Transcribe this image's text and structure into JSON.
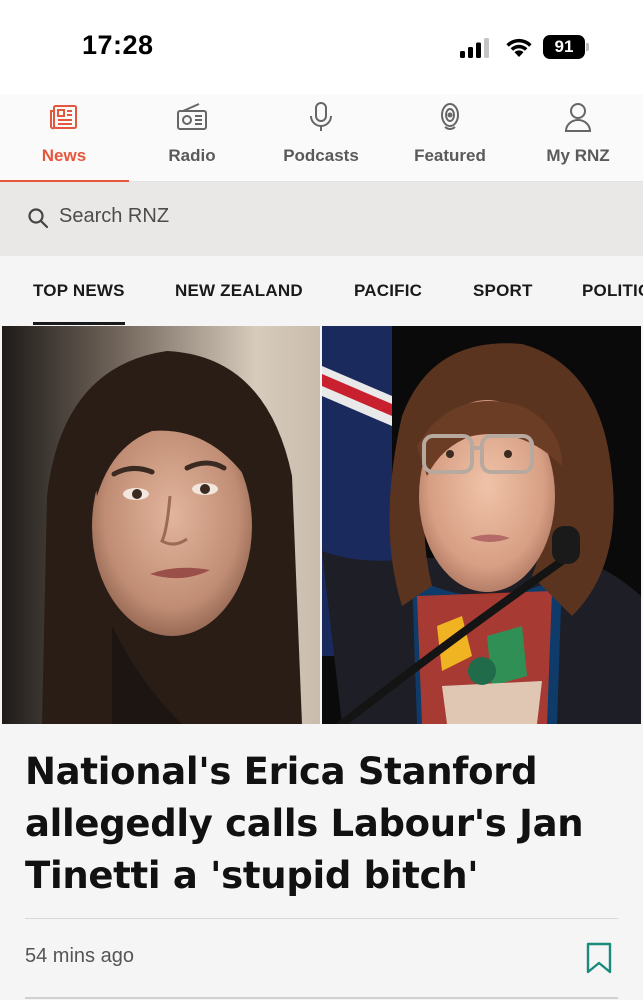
{
  "status_bar": {
    "time": "17:28",
    "battery": "91"
  },
  "nav": {
    "items": [
      {
        "label": "News",
        "icon": "newspaper-icon",
        "active": true
      },
      {
        "label": "Radio",
        "icon": "radio-icon",
        "active": false
      },
      {
        "label": "Podcasts",
        "icon": "microphone-icon",
        "active": false
      },
      {
        "label": "Featured",
        "icon": "featured-icon",
        "active": false
      },
      {
        "label": "My RNZ",
        "icon": "person-icon",
        "active": false
      }
    ]
  },
  "search": {
    "placeholder": "Search RNZ"
  },
  "tabs": [
    {
      "label": "TOP NEWS",
      "active": true
    },
    {
      "label": "NEW ZEALAND",
      "active": false
    },
    {
      "label": "PACIFIC",
      "active": false
    },
    {
      "label": "SPORT",
      "active": false
    },
    {
      "label": "POLITICS",
      "active": false
    }
  ],
  "article": {
    "headline": "National's Erica Stanford allegedly calls Labour's Jan Tinetti a 'stupid bitch'",
    "time_ago": "54 mins ago"
  },
  "colors": {
    "accent": "#e4573d",
    "bookmark": "#1a8a7a"
  }
}
